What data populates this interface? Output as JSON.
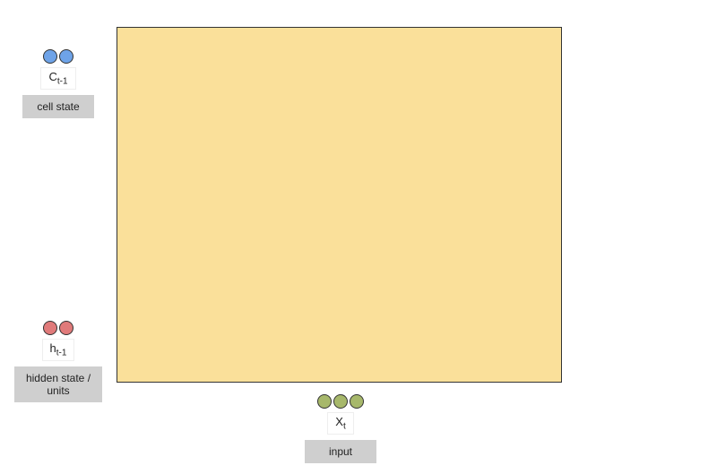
{
  "cell_state": {
    "symbol_main": "C",
    "symbol_sub": "t-1",
    "label": "cell state",
    "circle_color": "blue",
    "circle_count": 2
  },
  "hidden_state": {
    "symbol_main": "h",
    "symbol_sub": "t-1",
    "label": "hidden state / units",
    "circle_color": "red",
    "circle_count": 2
  },
  "input": {
    "symbol_main": "X",
    "symbol_sub": "t",
    "label": "input",
    "circle_color": "green",
    "circle_count": 3
  }
}
